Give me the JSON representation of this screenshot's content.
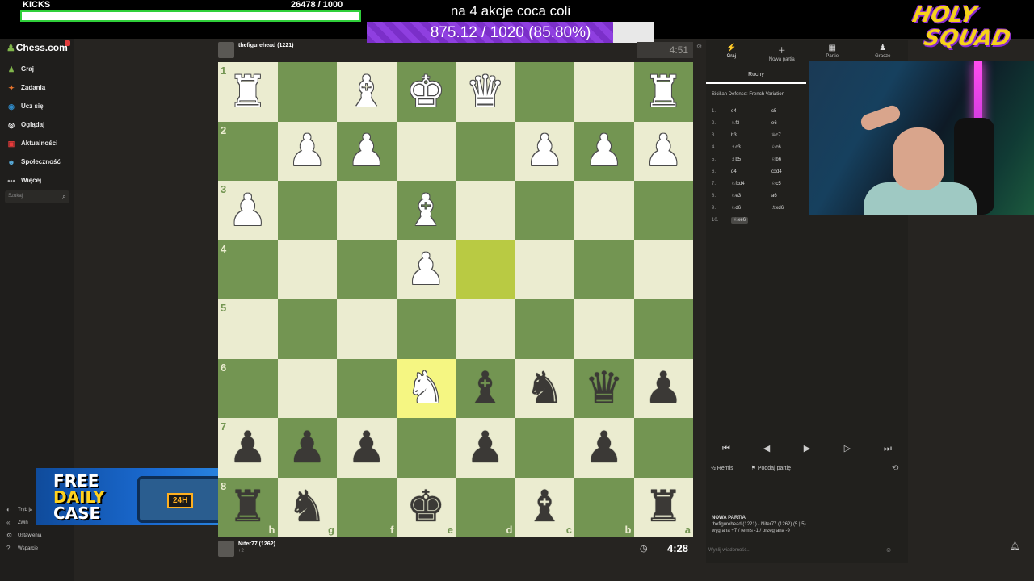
{
  "overlay": {
    "kicks_label": "KICKS",
    "kicks_count": "26478  / 1000",
    "kicks_progress": 1.0,
    "goal_title": "na 4 akcje coca coli",
    "goal_text": "875.12 / 1020 (85.80%)",
    "goal_progress": 0.858,
    "logo_line1": "HOLY",
    "logo_line2": "SQUAD"
  },
  "sidebar": {
    "brand": "Chess.com",
    "items": [
      {
        "label": "Graj",
        "icon": "play-icon",
        "color": "#81b64c",
        "glyph": "♟"
      },
      {
        "label": "Zadania",
        "icon": "puzzle-icon",
        "color": "#e8742c",
        "glyph": "✦"
      },
      {
        "label": "Ucz się",
        "icon": "learn-icon",
        "color": "#2f8ac7",
        "glyph": "◉"
      },
      {
        "label": "Oglądaj",
        "icon": "watch-icon",
        "color": "#ffffff",
        "glyph": "◎"
      },
      {
        "label": "Aktualności",
        "icon": "news-icon",
        "color": "#e83b3b",
        "glyph": "▣"
      },
      {
        "label": "Społeczność",
        "icon": "community-icon",
        "color": "#5ab0e0",
        "glyph": "☻"
      },
      {
        "label": "Więcej",
        "icon": "more-icon",
        "color": "#aaaaaa",
        "glyph": "•••"
      }
    ],
    "search_placeholder": "Szukaj",
    "bottom_items": [
      {
        "label": "Tryb ja",
        "icon": "theme-icon",
        "glyph": "◐"
      },
      {
        "label": "Zwiń",
        "icon": "collapse-icon",
        "glyph": "«"
      },
      {
        "label": "Ustawienia",
        "icon": "settings-icon",
        "glyph": "⚙"
      },
      {
        "label": "Wsparcie",
        "icon": "help-icon",
        "glyph": "?"
      }
    ]
  },
  "ad": {
    "line1": "FREE",
    "line2": "DAILY",
    "line3": "CASE",
    "box_tag": "24H"
  },
  "top_player": {
    "name": "thefigurehead (1221)",
    "sub": "",
    "clock": "4:51"
  },
  "bottom_player": {
    "name": "Niter77 (1262)",
    "sub": "+2",
    "clock": "4:28"
  },
  "board": {
    "ranks": [
      "1",
      "2",
      "3",
      "4",
      "5",
      "6",
      "7",
      "8"
    ],
    "files": [
      "h",
      "g",
      "f",
      "e",
      "d",
      "c",
      "b",
      "a"
    ],
    "rows": [
      [
        "wR",
        "",
        "wB",
        "wK",
        "wQ",
        "",
        "",
        "wR"
      ],
      [
        "",
        "wP",
        "wP",
        "",
        "",
        "wP",
        "wP",
        "wP"
      ],
      [
        "wP",
        "",
        "",
        "wB",
        "",
        "",
        "",
        ""
      ],
      [
        "",
        "",
        "",
        "wP",
        "",
        "",
        "",
        ""
      ],
      [
        "",
        "",
        "",
        "",
        "",
        "",
        "",
        ""
      ],
      [
        "",
        "",
        "",
        "wN",
        "bB",
        "bN",
        "bQ",
        "bP"
      ],
      [
        "bP",
        "bP",
        "bP",
        "",
        "bP",
        "",
        "bP",
        ""
      ],
      [
        "bR",
        "bN",
        "",
        "bK",
        "",
        "bB",
        "",
        "bR"
      ]
    ],
    "highlights": [
      [
        3,
        4
      ],
      [
        5,
        3
      ]
    ]
  },
  "panel": {
    "tabs": [
      {
        "label": "Graj",
        "glyph": "⚡"
      },
      {
        "label": "Nowa partia",
        "glyph": "＋"
      },
      {
        "label": "Partie",
        "glyph": "▦"
      },
      {
        "label": "Gracze",
        "glyph": "♟"
      }
    ],
    "moves_header": "Ruchy",
    "opening": "Sicilian Defense: French Variation",
    "moves": [
      {
        "n": "1.",
        "w": "e4",
        "b": "c5"
      },
      {
        "n": "2.",
        "w": "♘f3",
        "b": "e6"
      },
      {
        "n": "3.",
        "w": "h3",
        "b": "♕c7"
      },
      {
        "n": "4.",
        "w": "♗c3",
        "b": "♘c6"
      },
      {
        "n": "5.",
        "w": "♗b5",
        "b": "♘b6"
      },
      {
        "n": "6.",
        "w": "d4",
        "b": "cxd4"
      },
      {
        "n": "7.",
        "w": "♘fxd4",
        "b": "♘c5"
      },
      {
        "n": "8.",
        "w": "♘e3",
        "b": "a6"
      },
      {
        "n": "9.",
        "w": "♘d6+",
        "b": "♗xd6"
      },
      {
        "n": "10.",
        "w": "♘xe6",
        "b": ""
      }
    ],
    "draw_label": "Remis",
    "resign_label": "Poddaj partię",
    "game_title": "NOWA PARTIA",
    "game_line1": "thefigurehead (1221) - Niter77 (1262) (5 | 5)",
    "game_line2": "wygrana +7 / remis -1 / przegrana -9",
    "chat_placeholder": "Wyślij wiadomość..."
  }
}
